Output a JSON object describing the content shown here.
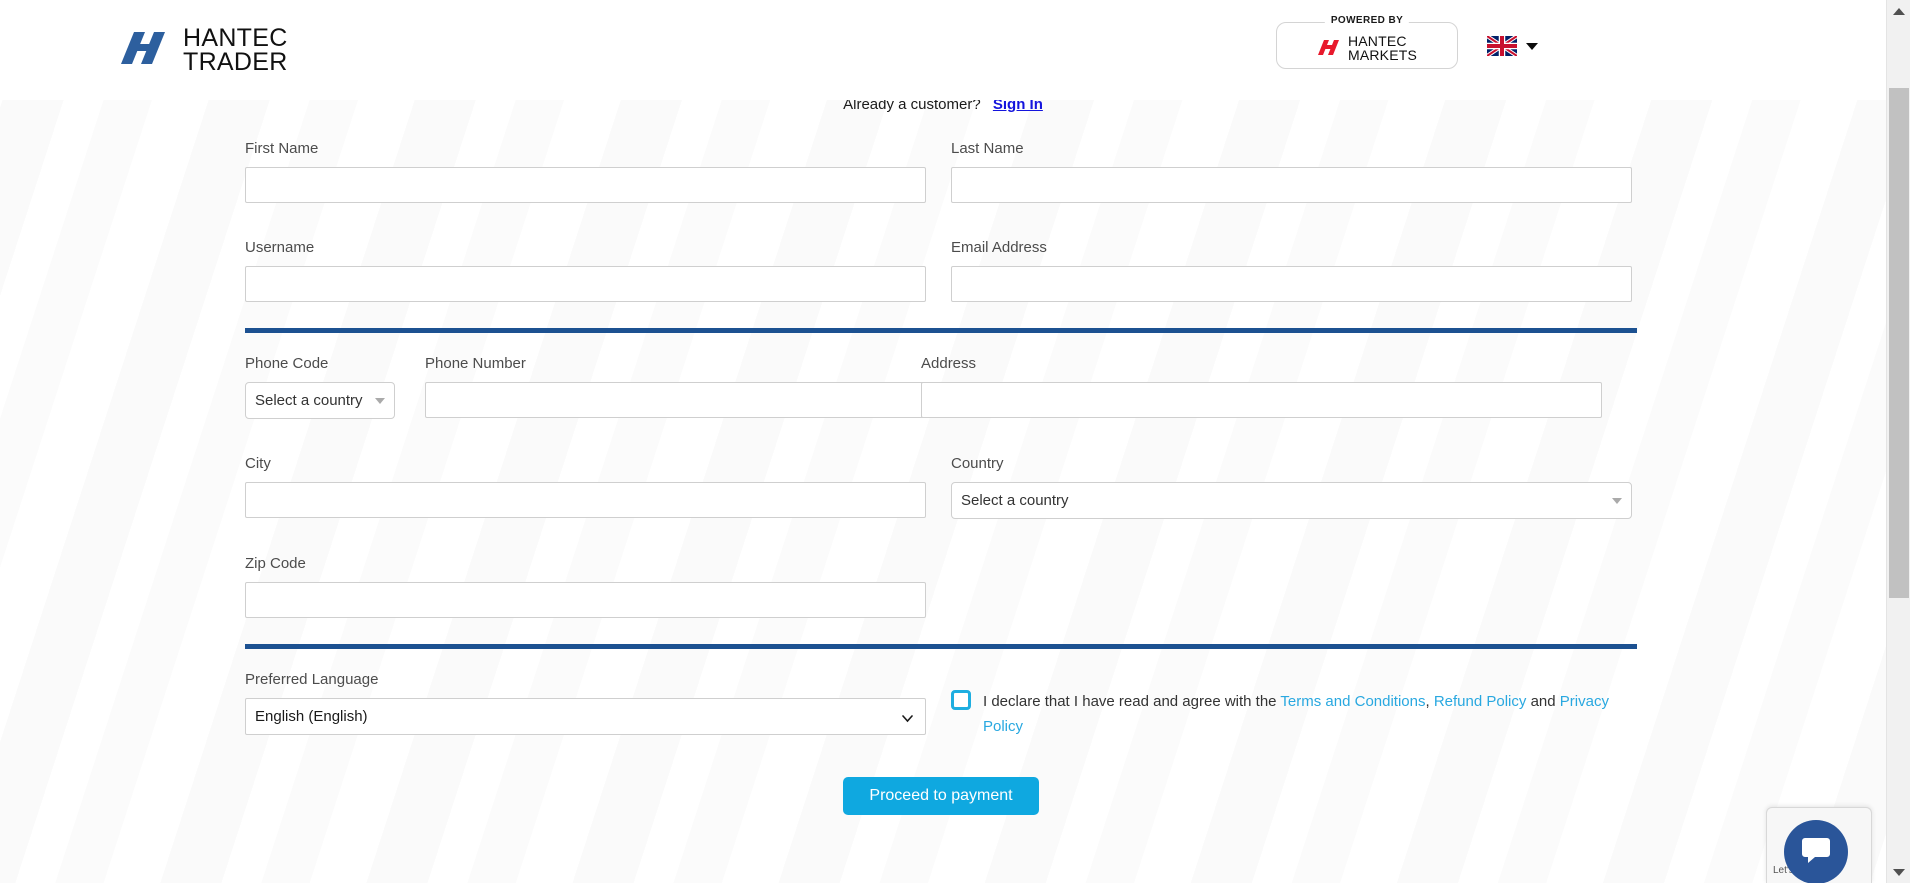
{
  "header": {
    "logo": {
      "line1": "HANTEC",
      "line2": "TRADER",
      "icon": "hantec-trader-logo"
    },
    "powered_by": {
      "label": "POWERED BY",
      "brand_line1": "HANTEC",
      "brand_line2": "MARKETS"
    },
    "language_selector": {
      "flag": "uk-flag-icon",
      "caret": "chevron-down-icon"
    }
  },
  "signin": {
    "prompt": "Already a customer?",
    "link": "Sign In"
  },
  "form": {
    "first_name": {
      "label": "First Name",
      "value": "",
      "placeholder": ""
    },
    "last_name": {
      "label": "Last Name",
      "value": "",
      "placeholder": ""
    },
    "username": {
      "label": "Username",
      "value": "",
      "placeholder": ""
    },
    "email": {
      "label": "Email Address",
      "value": "",
      "placeholder": ""
    },
    "phone_code": {
      "label": "Phone Code",
      "value": "Select a country"
    },
    "phone_number": {
      "label": "Phone Number",
      "value": "",
      "placeholder": ""
    },
    "address": {
      "label": "Address",
      "value": "",
      "placeholder": ""
    },
    "city": {
      "label": "City",
      "value": "",
      "placeholder": ""
    },
    "country": {
      "label": "Country",
      "value": "Select a country"
    },
    "zip_code": {
      "label": "Zip Code",
      "value": "",
      "placeholder": ""
    },
    "preferred_language": {
      "label": "Preferred Language",
      "value": "English (English)",
      "options": [
        "English (English)"
      ]
    },
    "terms": {
      "intro": "I declare that I have read and agree with the ",
      "link_terms": "Terms and Conditions",
      "separator1": ", ",
      "link_refund": "Refund Policy",
      "separator2": " and ",
      "link_privacy": "Privacy Policy",
      "checked": false
    },
    "submit_label": "Proceed to payment"
  },
  "chat": {
    "icon": "chat-bubble-icon",
    "caption": "Let's Chat"
  },
  "colors": {
    "divider_blue": "#1c5191",
    "accent_cyan": "#0fa8e0",
    "link_blue": "#29a8e0",
    "signin_link": "#1414dd",
    "chat_blue": "#2a5599"
  }
}
